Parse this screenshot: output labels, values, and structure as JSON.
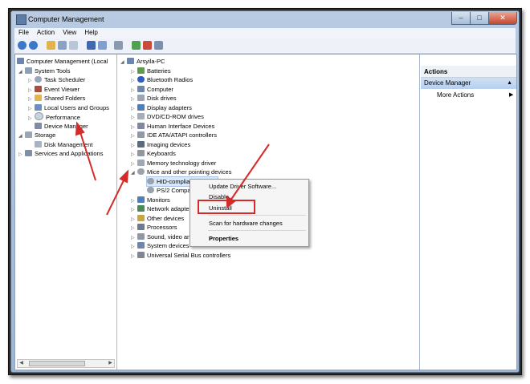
{
  "window": {
    "title": "Computer Management"
  },
  "menu": [
    "File",
    "Action",
    "View",
    "Help"
  ],
  "left_tree": {
    "root": "Computer Management (Local",
    "items": [
      "System Tools",
      "Task Scheduler",
      "Event Viewer",
      "Shared Folders",
      "Local Users and Groups",
      "Performance",
      "Device Manager",
      "Storage",
      "Disk Management",
      "Services and Applications"
    ]
  },
  "device_tree": {
    "root": "Arsyila-PC",
    "items": [
      "Batteries",
      "Bluetooth Radios",
      "Computer",
      "Disk drives",
      "Display adapters",
      "DVD/CD-ROM drives",
      "Human Interface Devices",
      "IDE ATA/ATAPI controllers",
      "Imaging devices",
      "Keyboards",
      "Memory technology driver",
      "Mice and other pointing devices",
      "HID-compliant mouse",
      "PS/2 Compat",
      "Monitors",
      "Network adapter",
      "Other devices",
      "Processors",
      "Sound, video and",
      "System devices",
      "Universal Serial Bus controllers"
    ]
  },
  "context_menu": {
    "items": [
      "Update Driver Software...",
      "Disable",
      "Uninstall",
      "Scan for hardware changes",
      "Properties"
    ]
  },
  "actions": {
    "header": "Actions",
    "section": "Device Manager",
    "more": "More Actions"
  },
  "colors": {
    "highlight_red": "#d42a2a",
    "selection": "#dbe8f8"
  }
}
